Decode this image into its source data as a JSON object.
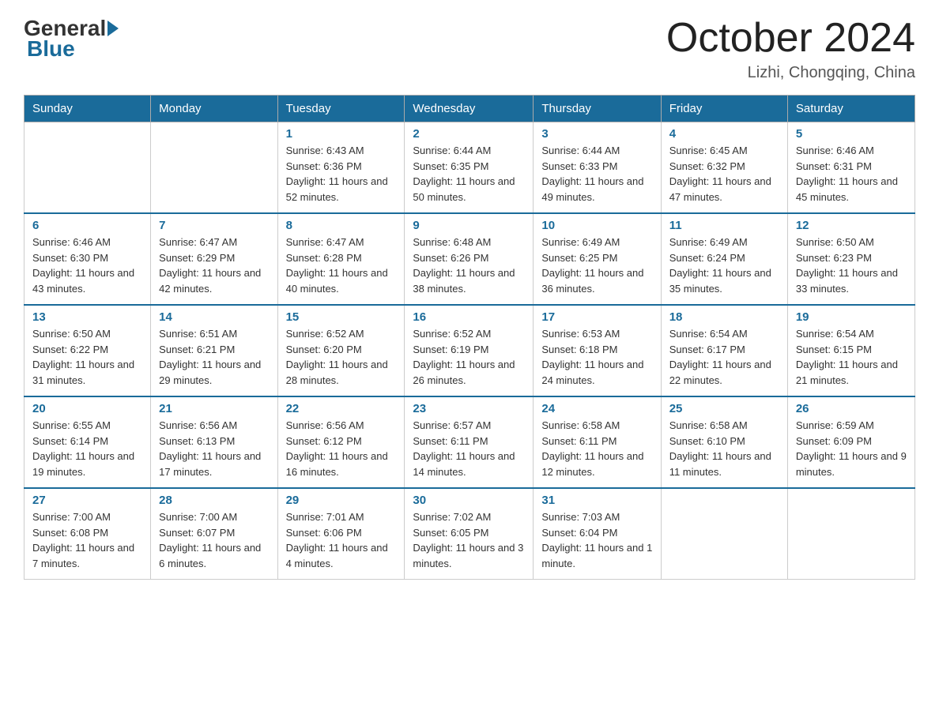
{
  "header": {
    "logo_text_general": "General",
    "logo_text_blue": "Blue",
    "month_year": "October 2024",
    "location": "Lizhi, Chongqing, China"
  },
  "days_of_week": [
    "Sunday",
    "Monday",
    "Tuesday",
    "Wednesday",
    "Thursday",
    "Friday",
    "Saturday"
  ],
  "weeks": [
    [
      {
        "day": "",
        "sunrise": "",
        "sunset": "",
        "daylight": ""
      },
      {
        "day": "",
        "sunrise": "",
        "sunset": "",
        "daylight": ""
      },
      {
        "day": "1",
        "sunrise": "Sunrise: 6:43 AM",
        "sunset": "Sunset: 6:36 PM",
        "daylight": "Daylight: 11 hours and 52 minutes."
      },
      {
        "day": "2",
        "sunrise": "Sunrise: 6:44 AM",
        "sunset": "Sunset: 6:35 PM",
        "daylight": "Daylight: 11 hours and 50 minutes."
      },
      {
        "day": "3",
        "sunrise": "Sunrise: 6:44 AM",
        "sunset": "Sunset: 6:33 PM",
        "daylight": "Daylight: 11 hours and 49 minutes."
      },
      {
        "day": "4",
        "sunrise": "Sunrise: 6:45 AM",
        "sunset": "Sunset: 6:32 PM",
        "daylight": "Daylight: 11 hours and 47 minutes."
      },
      {
        "day": "5",
        "sunrise": "Sunrise: 6:46 AM",
        "sunset": "Sunset: 6:31 PM",
        "daylight": "Daylight: 11 hours and 45 minutes."
      }
    ],
    [
      {
        "day": "6",
        "sunrise": "Sunrise: 6:46 AM",
        "sunset": "Sunset: 6:30 PM",
        "daylight": "Daylight: 11 hours and 43 minutes."
      },
      {
        "day": "7",
        "sunrise": "Sunrise: 6:47 AM",
        "sunset": "Sunset: 6:29 PM",
        "daylight": "Daylight: 11 hours and 42 minutes."
      },
      {
        "day": "8",
        "sunrise": "Sunrise: 6:47 AM",
        "sunset": "Sunset: 6:28 PM",
        "daylight": "Daylight: 11 hours and 40 minutes."
      },
      {
        "day": "9",
        "sunrise": "Sunrise: 6:48 AM",
        "sunset": "Sunset: 6:26 PM",
        "daylight": "Daylight: 11 hours and 38 minutes."
      },
      {
        "day": "10",
        "sunrise": "Sunrise: 6:49 AM",
        "sunset": "Sunset: 6:25 PM",
        "daylight": "Daylight: 11 hours and 36 minutes."
      },
      {
        "day": "11",
        "sunrise": "Sunrise: 6:49 AM",
        "sunset": "Sunset: 6:24 PM",
        "daylight": "Daylight: 11 hours and 35 minutes."
      },
      {
        "day": "12",
        "sunrise": "Sunrise: 6:50 AM",
        "sunset": "Sunset: 6:23 PM",
        "daylight": "Daylight: 11 hours and 33 minutes."
      }
    ],
    [
      {
        "day": "13",
        "sunrise": "Sunrise: 6:50 AM",
        "sunset": "Sunset: 6:22 PM",
        "daylight": "Daylight: 11 hours and 31 minutes."
      },
      {
        "day": "14",
        "sunrise": "Sunrise: 6:51 AM",
        "sunset": "Sunset: 6:21 PM",
        "daylight": "Daylight: 11 hours and 29 minutes."
      },
      {
        "day": "15",
        "sunrise": "Sunrise: 6:52 AM",
        "sunset": "Sunset: 6:20 PM",
        "daylight": "Daylight: 11 hours and 28 minutes."
      },
      {
        "day": "16",
        "sunrise": "Sunrise: 6:52 AM",
        "sunset": "Sunset: 6:19 PM",
        "daylight": "Daylight: 11 hours and 26 minutes."
      },
      {
        "day": "17",
        "sunrise": "Sunrise: 6:53 AM",
        "sunset": "Sunset: 6:18 PM",
        "daylight": "Daylight: 11 hours and 24 minutes."
      },
      {
        "day": "18",
        "sunrise": "Sunrise: 6:54 AM",
        "sunset": "Sunset: 6:17 PM",
        "daylight": "Daylight: 11 hours and 22 minutes."
      },
      {
        "day": "19",
        "sunrise": "Sunrise: 6:54 AM",
        "sunset": "Sunset: 6:15 PM",
        "daylight": "Daylight: 11 hours and 21 minutes."
      }
    ],
    [
      {
        "day": "20",
        "sunrise": "Sunrise: 6:55 AM",
        "sunset": "Sunset: 6:14 PM",
        "daylight": "Daylight: 11 hours and 19 minutes."
      },
      {
        "day": "21",
        "sunrise": "Sunrise: 6:56 AM",
        "sunset": "Sunset: 6:13 PM",
        "daylight": "Daylight: 11 hours and 17 minutes."
      },
      {
        "day": "22",
        "sunrise": "Sunrise: 6:56 AM",
        "sunset": "Sunset: 6:12 PM",
        "daylight": "Daylight: 11 hours and 16 minutes."
      },
      {
        "day": "23",
        "sunrise": "Sunrise: 6:57 AM",
        "sunset": "Sunset: 6:11 PM",
        "daylight": "Daylight: 11 hours and 14 minutes."
      },
      {
        "day": "24",
        "sunrise": "Sunrise: 6:58 AM",
        "sunset": "Sunset: 6:11 PM",
        "daylight": "Daylight: 11 hours and 12 minutes."
      },
      {
        "day": "25",
        "sunrise": "Sunrise: 6:58 AM",
        "sunset": "Sunset: 6:10 PM",
        "daylight": "Daylight: 11 hours and 11 minutes."
      },
      {
        "day": "26",
        "sunrise": "Sunrise: 6:59 AM",
        "sunset": "Sunset: 6:09 PM",
        "daylight": "Daylight: 11 hours and 9 minutes."
      }
    ],
    [
      {
        "day": "27",
        "sunrise": "Sunrise: 7:00 AM",
        "sunset": "Sunset: 6:08 PM",
        "daylight": "Daylight: 11 hours and 7 minutes."
      },
      {
        "day": "28",
        "sunrise": "Sunrise: 7:00 AM",
        "sunset": "Sunset: 6:07 PM",
        "daylight": "Daylight: 11 hours and 6 minutes."
      },
      {
        "day": "29",
        "sunrise": "Sunrise: 7:01 AM",
        "sunset": "Sunset: 6:06 PM",
        "daylight": "Daylight: 11 hours and 4 minutes."
      },
      {
        "day": "30",
        "sunrise": "Sunrise: 7:02 AM",
        "sunset": "Sunset: 6:05 PM",
        "daylight": "Daylight: 11 hours and 3 minutes."
      },
      {
        "day": "31",
        "sunrise": "Sunrise: 7:03 AM",
        "sunset": "Sunset: 6:04 PM",
        "daylight": "Daylight: 11 hours and 1 minute."
      },
      {
        "day": "",
        "sunrise": "",
        "sunset": "",
        "daylight": ""
      },
      {
        "day": "",
        "sunrise": "",
        "sunset": "",
        "daylight": ""
      }
    ]
  ]
}
